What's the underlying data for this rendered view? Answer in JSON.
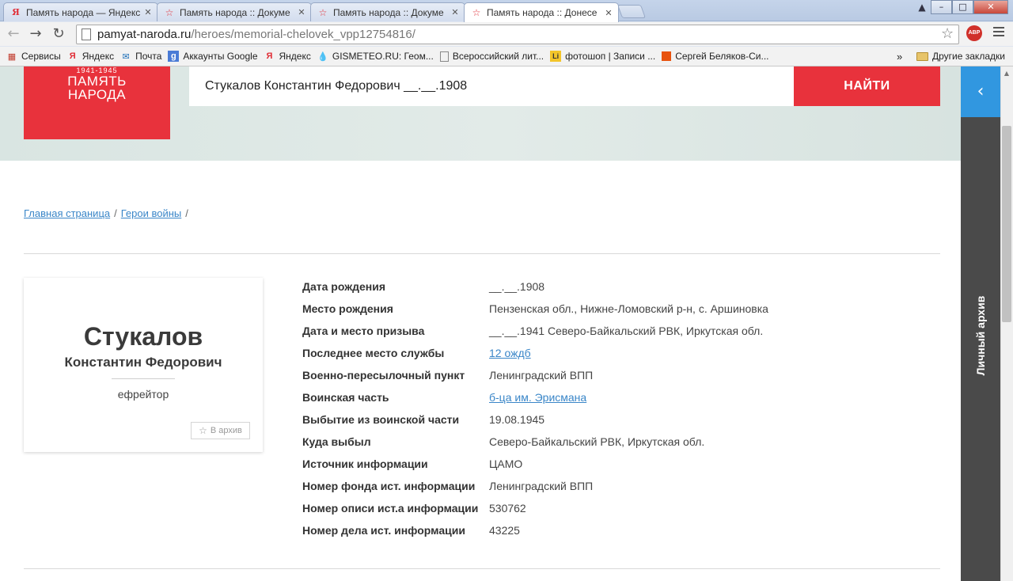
{
  "browser": {
    "tabs": [
      {
        "title": "Память народа — Яндекс",
        "icon": "yandex-icon"
      },
      {
        "title": "Память народа :: Докуме",
        "icon": "star-icon"
      },
      {
        "title": "Память народа :: Докуме",
        "icon": "star-icon"
      },
      {
        "title": "Память народа :: Донесе",
        "icon": "star-icon"
      }
    ],
    "url_host": "pamyat-naroda.ru",
    "url_path": "/heroes/memorial-chelovek_vpp12754816/",
    "abp_label": "ABP",
    "bookmarks": [
      {
        "label": "Сервисы"
      },
      {
        "label": "Яндекс"
      },
      {
        "label": "Почта"
      },
      {
        "label": "Аккаунты Google"
      },
      {
        "label": "Яндекс"
      },
      {
        "label": "GISMETEO.RU: Геом..."
      },
      {
        "label": "Всероссийский лит..."
      },
      {
        "label": "фотошоп | Записи ..."
      },
      {
        "label": "Сергей Беляков-Си..."
      }
    ],
    "bookmarks_more": "»",
    "other_bookmarks": "Другие закладки"
  },
  "header": {
    "logo_years": "1941-1945",
    "logo_line1": "ПАМЯТЬ",
    "logo_line2": "НАРОДА",
    "search_value": "Стукалов Константин Федорович __.__.1908",
    "search_button": "НАЙТИ"
  },
  "sidebar": {
    "toggle_icon": "chevron-left-icon",
    "label": "Личный архив"
  },
  "breadcrumbs": {
    "home": "Главная страница",
    "heroes": "Герои войны",
    "separator": "/"
  },
  "person": {
    "surname": "Стукалов",
    "given_names": "Константин Федорович",
    "rank": "ефрейтор",
    "archive_button": "В архив"
  },
  "details": [
    {
      "label": "Дата рождения",
      "value": "__.__.1908",
      "link": false
    },
    {
      "label": "Место рождения",
      "value": "Пензенская обл., Нижне-Ломовский р-н, с. Аршиновка",
      "link": false
    },
    {
      "label": "Дата и место призыва",
      "value": "__.__.1941 Северо-Байкальский РВК, Иркутская обл.",
      "link": false
    },
    {
      "label": "Последнее место службы",
      "value": "12 ождб",
      "link": true
    },
    {
      "label": "Военно-пересылочный пункт",
      "value": "Ленинградский ВПП",
      "link": false
    },
    {
      "label": "Воинская часть",
      "value": "б-ца им. Эрисмана",
      "link": true
    },
    {
      "label": "Выбытие из воинской части",
      "value": "19.08.1945",
      "link": false
    },
    {
      "label": "Куда выбыл",
      "value": "Северо-Байкальский РВК, Иркутская обл.",
      "link": false
    },
    {
      "label": "Источник информации",
      "value": "ЦАМО",
      "link": false
    },
    {
      "label": "Номер фонда ист. информации",
      "value": "Ленинградский ВПП",
      "link": false
    },
    {
      "label": "Номер описи ист.а информации",
      "value": "530762",
      "link": false
    },
    {
      "label": "Номер дела ист. информации",
      "value": "43225",
      "link": false
    }
  ],
  "colors": {
    "brand_red": "#e8323c",
    "sidebar_blue": "#3197e0",
    "sidebar_dark": "#4a4a4a",
    "link_blue": "#3a86c8"
  }
}
